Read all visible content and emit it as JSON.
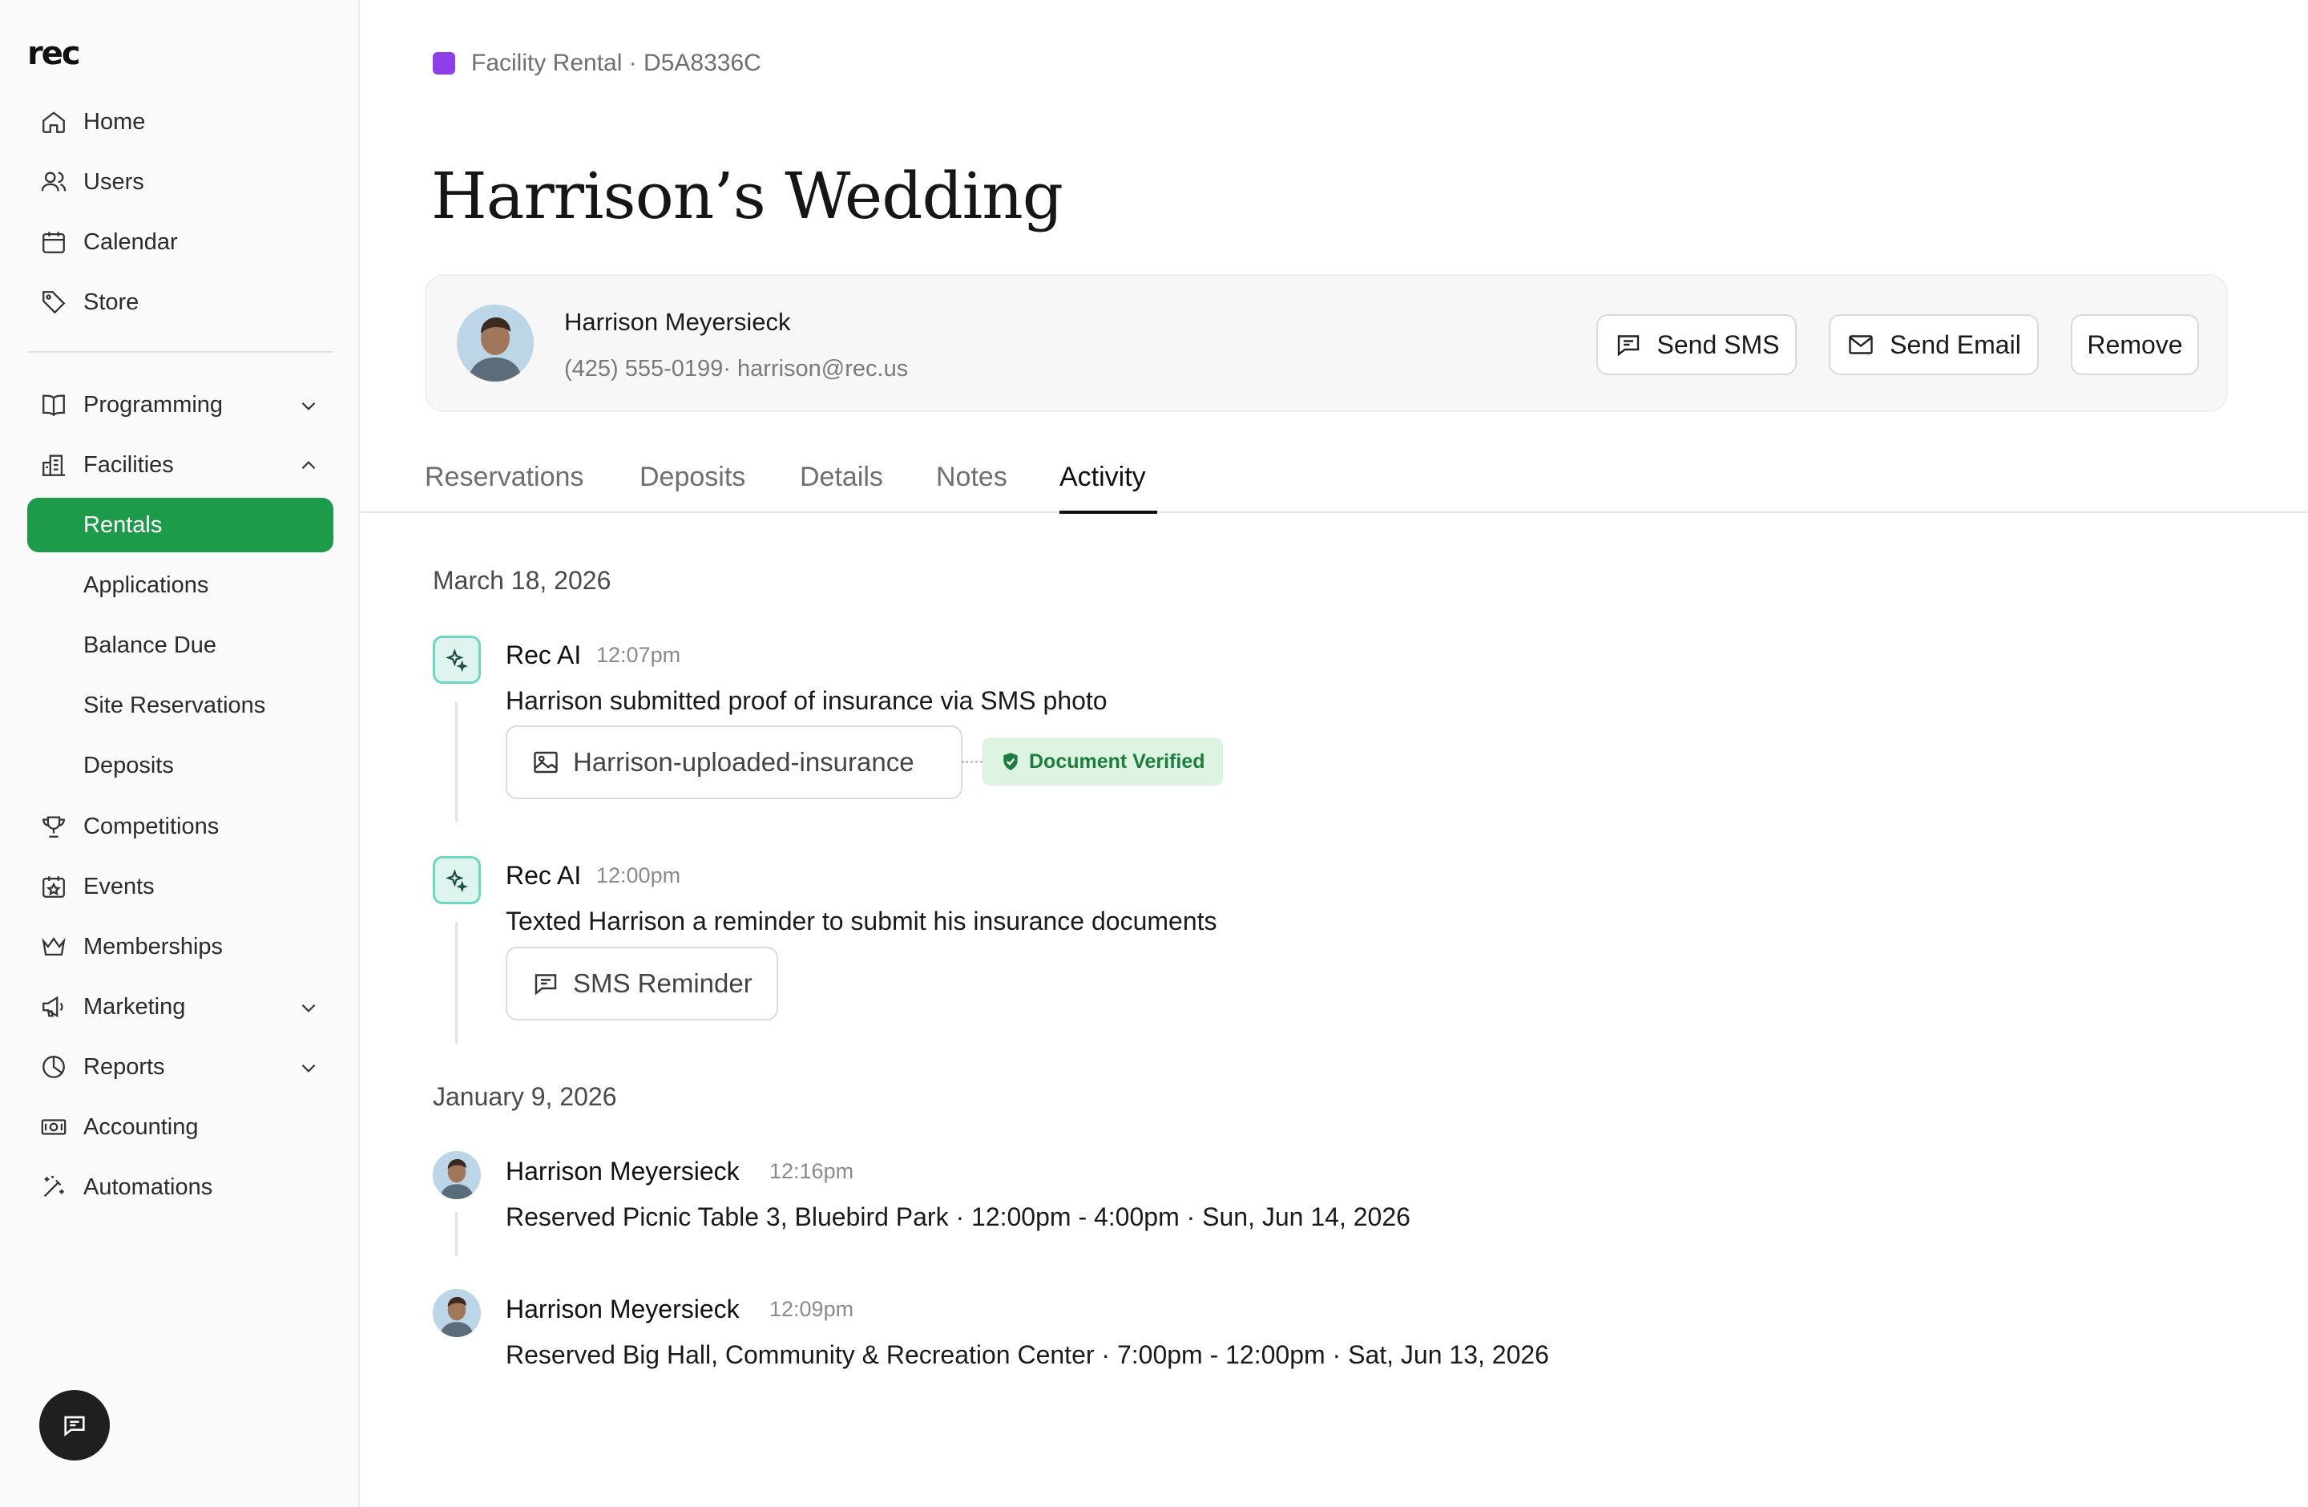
{
  "app": {
    "logo": "rec"
  },
  "sidebar": {
    "items": [
      {
        "label": "Home",
        "icon": "home-icon"
      },
      {
        "label": "Users",
        "icon": "users-icon"
      },
      {
        "label": "Calendar",
        "icon": "calendar-icon"
      },
      {
        "label": "Store",
        "icon": "tag-icon"
      },
      {
        "label": "Programming",
        "icon": "book-icon",
        "chevron": "down"
      },
      {
        "label": "Facilities",
        "icon": "building-icon",
        "chevron": "up"
      },
      {
        "label": "Rentals",
        "active": true
      },
      {
        "label": "Applications"
      },
      {
        "label": "Balance Due"
      },
      {
        "label": "Site Reservations"
      },
      {
        "label": "Deposits"
      },
      {
        "label": "Competitions",
        "icon": "trophy-icon"
      },
      {
        "label": "Events",
        "icon": "calendar-star-icon"
      },
      {
        "label": "Memberships",
        "icon": "crown-icon"
      },
      {
        "label": "Marketing",
        "icon": "megaphone-icon",
        "chevron": "down"
      },
      {
        "label": "Reports",
        "icon": "pie-chart-icon",
        "chevron": "down"
      },
      {
        "label": "Accounting",
        "icon": "money-icon"
      },
      {
        "label": "Automations",
        "icon": "magic-wand-icon"
      }
    ],
    "active_color": "#1e9a4b"
  },
  "breadcrumb": {
    "text": "Facility Rental · D5A8336C",
    "swatch_color": "#8e3fe8"
  },
  "page": {
    "title": "Harrison’s Wedding"
  },
  "contact": {
    "name": "Harrison Meyersieck",
    "details": "(425) 555-0199· harrison@rec.us",
    "buttons": {
      "sms": "Send SMS",
      "email": "Send Email",
      "remove": "Remove"
    }
  },
  "tabs": [
    "Reservations",
    "Deposits",
    "Details",
    "Notes",
    "Activity"
  ],
  "active_tab": "Activity",
  "activity": {
    "groups": [
      {
        "date": "March 18, 2026",
        "events": [
          {
            "actor": "Rec AI",
            "time": "12:07pm",
            "text": "Harrison submitted proof of insurance via SMS photo",
            "attachment": "Harrison-uploaded-insurance",
            "badge": "Document Verified"
          },
          {
            "actor": "Rec AI",
            "time": "12:00pm",
            "text": "Texted Harrison a reminder to submit his insurance documents",
            "attachment": "SMS Reminder"
          }
        ]
      },
      {
        "date": "January 9, 2026",
        "events": [
          {
            "actor": "Harrison Meyersieck",
            "time": "12:16pm",
            "text": "Reserved Picnic Table 3, Bluebird Park · 12:00pm - 4:00pm · Sun, Jun 14, 2026"
          },
          {
            "actor": "Harrison Meyersieck",
            "time": "12:09pm",
            "text": "Reserved Big Hall, Community & Recreation Center · 7:00pm - 12:00pm · Sat, Jun 13, 2026"
          }
        ]
      }
    ]
  }
}
